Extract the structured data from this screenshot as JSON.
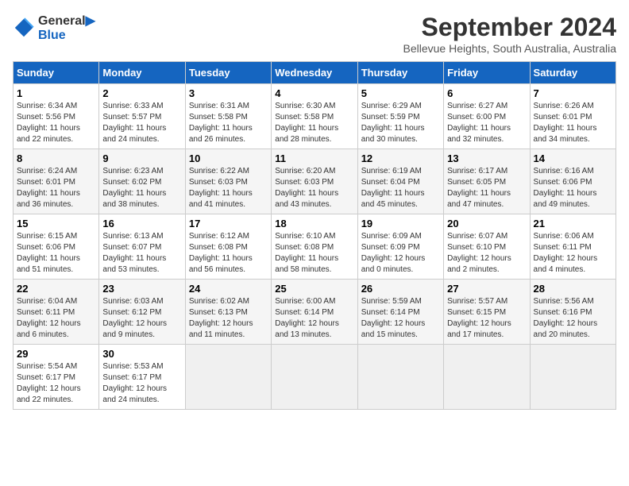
{
  "logo": {
    "line1": "General",
    "line2": "Blue"
  },
  "title": "September 2024",
  "subtitle": "Bellevue Heights, South Australia, Australia",
  "days_of_week": [
    "Sunday",
    "Monday",
    "Tuesday",
    "Wednesday",
    "Thursday",
    "Friday",
    "Saturday"
  ],
  "weeks": [
    [
      {
        "day": 1,
        "info": "Sunrise: 6:34 AM\nSunset: 5:56 PM\nDaylight: 11 hours\nand 22 minutes."
      },
      {
        "day": 2,
        "info": "Sunrise: 6:33 AM\nSunset: 5:57 PM\nDaylight: 11 hours\nand 24 minutes."
      },
      {
        "day": 3,
        "info": "Sunrise: 6:31 AM\nSunset: 5:58 PM\nDaylight: 11 hours\nand 26 minutes."
      },
      {
        "day": 4,
        "info": "Sunrise: 6:30 AM\nSunset: 5:58 PM\nDaylight: 11 hours\nand 28 minutes."
      },
      {
        "day": 5,
        "info": "Sunrise: 6:29 AM\nSunset: 5:59 PM\nDaylight: 11 hours\nand 30 minutes."
      },
      {
        "day": 6,
        "info": "Sunrise: 6:27 AM\nSunset: 6:00 PM\nDaylight: 11 hours\nand 32 minutes."
      },
      {
        "day": 7,
        "info": "Sunrise: 6:26 AM\nSunset: 6:01 PM\nDaylight: 11 hours\nand 34 minutes."
      }
    ],
    [
      {
        "day": 8,
        "info": "Sunrise: 6:24 AM\nSunset: 6:01 PM\nDaylight: 11 hours\nand 36 minutes."
      },
      {
        "day": 9,
        "info": "Sunrise: 6:23 AM\nSunset: 6:02 PM\nDaylight: 11 hours\nand 38 minutes."
      },
      {
        "day": 10,
        "info": "Sunrise: 6:22 AM\nSunset: 6:03 PM\nDaylight: 11 hours\nand 41 minutes."
      },
      {
        "day": 11,
        "info": "Sunrise: 6:20 AM\nSunset: 6:03 PM\nDaylight: 11 hours\nand 43 minutes."
      },
      {
        "day": 12,
        "info": "Sunrise: 6:19 AM\nSunset: 6:04 PM\nDaylight: 11 hours\nand 45 minutes."
      },
      {
        "day": 13,
        "info": "Sunrise: 6:17 AM\nSunset: 6:05 PM\nDaylight: 11 hours\nand 47 minutes."
      },
      {
        "day": 14,
        "info": "Sunrise: 6:16 AM\nSunset: 6:06 PM\nDaylight: 11 hours\nand 49 minutes."
      }
    ],
    [
      {
        "day": 15,
        "info": "Sunrise: 6:15 AM\nSunset: 6:06 PM\nDaylight: 11 hours\nand 51 minutes."
      },
      {
        "day": 16,
        "info": "Sunrise: 6:13 AM\nSunset: 6:07 PM\nDaylight: 11 hours\nand 53 minutes."
      },
      {
        "day": 17,
        "info": "Sunrise: 6:12 AM\nSunset: 6:08 PM\nDaylight: 11 hours\nand 56 minutes."
      },
      {
        "day": 18,
        "info": "Sunrise: 6:10 AM\nSunset: 6:08 PM\nDaylight: 11 hours\nand 58 minutes."
      },
      {
        "day": 19,
        "info": "Sunrise: 6:09 AM\nSunset: 6:09 PM\nDaylight: 12 hours\nand 0 minutes."
      },
      {
        "day": 20,
        "info": "Sunrise: 6:07 AM\nSunset: 6:10 PM\nDaylight: 12 hours\nand 2 minutes."
      },
      {
        "day": 21,
        "info": "Sunrise: 6:06 AM\nSunset: 6:11 PM\nDaylight: 12 hours\nand 4 minutes."
      }
    ],
    [
      {
        "day": 22,
        "info": "Sunrise: 6:04 AM\nSunset: 6:11 PM\nDaylight: 12 hours\nand 6 minutes."
      },
      {
        "day": 23,
        "info": "Sunrise: 6:03 AM\nSunset: 6:12 PM\nDaylight: 12 hours\nand 9 minutes."
      },
      {
        "day": 24,
        "info": "Sunrise: 6:02 AM\nSunset: 6:13 PM\nDaylight: 12 hours\nand 11 minutes."
      },
      {
        "day": 25,
        "info": "Sunrise: 6:00 AM\nSunset: 6:14 PM\nDaylight: 12 hours\nand 13 minutes."
      },
      {
        "day": 26,
        "info": "Sunrise: 5:59 AM\nSunset: 6:14 PM\nDaylight: 12 hours\nand 15 minutes."
      },
      {
        "day": 27,
        "info": "Sunrise: 5:57 AM\nSunset: 6:15 PM\nDaylight: 12 hours\nand 17 minutes."
      },
      {
        "day": 28,
        "info": "Sunrise: 5:56 AM\nSunset: 6:16 PM\nDaylight: 12 hours\nand 20 minutes."
      }
    ],
    [
      {
        "day": 29,
        "info": "Sunrise: 5:54 AM\nSunset: 6:17 PM\nDaylight: 12 hours\nand 22 minutes."
      },
      {
        "day": 30,
        "info": "Sunrise: 5:53 AM\nSunset: 6:17 PM\nDaylight: 12 hours\nand 24 minutes."
      },
      null,
      null,
      null,
      null,
      null
    ]
  ]
}
